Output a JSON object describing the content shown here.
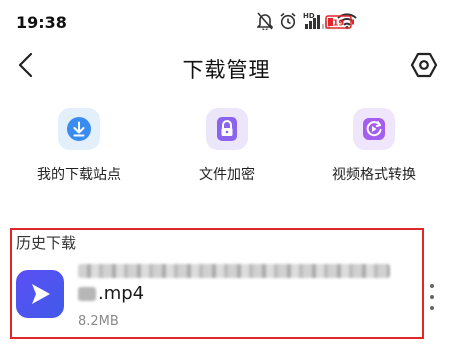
{
  "status_bar": {
    "time": "19:38",
    "network_label": "HD",
    "battery_level": "19"
  },
  "header": {
    "title": "下载管理"
  },
  "shortcuts": [
    {
      "label": "我的下载站点",
      "icon": "download-circle-icon",
      "color": "#3a8df0"
    },
    {
      "label": "文件加密",
      "icon": "lock-icon",
      "color": "#8a63ee"
    },
    {
      "label": "视频格式转换",
      "icon": "video-convert-icon",
      "color": "#a35ef0"
    }
  ],
  "history": {
    "section_title": "历史下载",
    "items": [
      {
        "name_suffix": ".mp4",
        "size": "8.2MB",
        "icon": "video-play-icon"
      }
    ]
  },
  "colors": {
    "highlight_border": "#e0262b",
    "battery_red": "#e0262b"
  }
}
